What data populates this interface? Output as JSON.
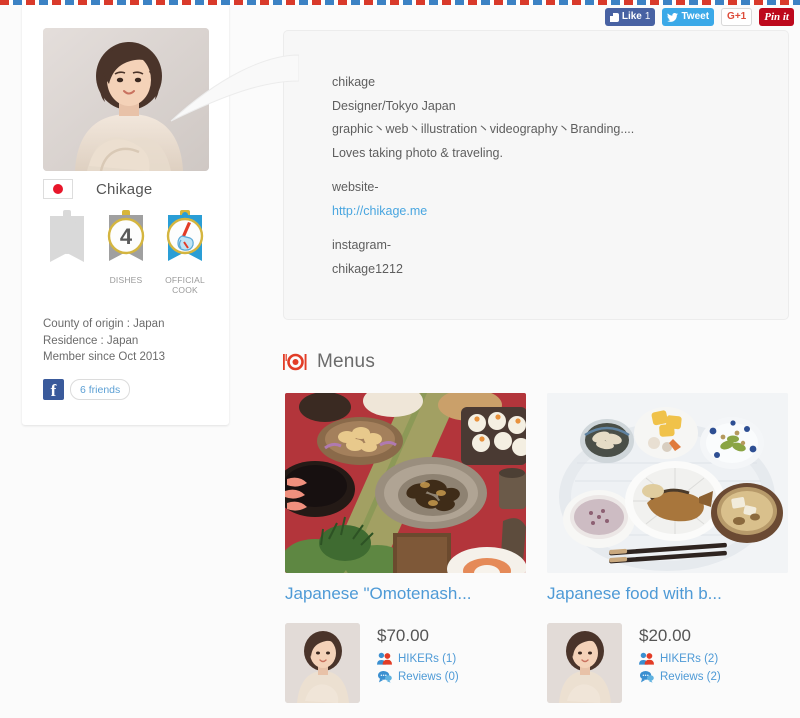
{
  "social": {
    "facebook_like": {
      "label": "Like",
      "count": "1",
      "icon": "thumbs-up-icon"
    },
    "twitter": {
      "label": "Tweet",
      "icon": "twitter-bird-icon"
    },
    "google_plus": {
      "label": "G+1"
    },
    "pinterest": {
      "label": "Pin it"
    }
  },
  "profile": {
    "avatar_alt": "chikage-portrait",
    "country_flag": "japan-flag",
    "name": "Chikage",
    "badges": [
      {
        "id": "locked-badge",
        "value": "",
        "label": "",
        "color": "#d9d9d9"
      },
      {
        "id": "dishes-badge",
        "value": "4",
        "label": "DISHES",
        "color": "#9c9c9c"
      },
      {
        "id": "official-cook-badge",
        "value": "",
        "label": "OFFICIAL COOK",
        "color": "#2a9ed6"
      }
    ],
    "info": [
      "County of origin : Japan",
      "Residence : Japan",
      "Member since Oct 2013"
    ],
    "friends": {
      "icon": "facebook-icon",
      "label": "6 friends"
    }
  },
  "bio": {
    "lines": [
      "chikage",
      "Designer/Tokyo Japan",
      "graphic丶web丶illustration丶videography丶Branding....",
      "Loves taking photo & traveling.",
      "",
      "website-",
      "LINK",
      "",
      "instagram-",
      "chikage1212"
    ],
    "website_label": "http://chikage.me"
  },
  "menus": {
    "icon": "plate-cutlery-icon",
    "heading": "Menus",
    "items": [
      {
        "title": "Japanese \"Omotenash...",
        "price": "$70.00",
        "hikers": "HIKERs (1)",
        "reviews": "Reviews (0)",
        "photo_alt": "japanese-feast-red-table",
        "host_alt": "chikage-portrait"
      },
      {
        "title": "Japanese food with b...",
        "price": "$20.00",
        "hikers": "HIKERs (2)",
        "reviews": "Reviews (2)",
        "photo_alt": "japanese-set-meal-white",
        "host_alt": "chikage-portrait"
      }
    ]
  },
  "colors": {
    "link": "#4e9ad6",
    "accent_red": "#e23c26",
    "facebook": "#3a5a9b",
    "twitter": "#3ba9e8",
    "pinterest": "#bd081c",
    "page_bg": "#f2f2f2"
  }
}
